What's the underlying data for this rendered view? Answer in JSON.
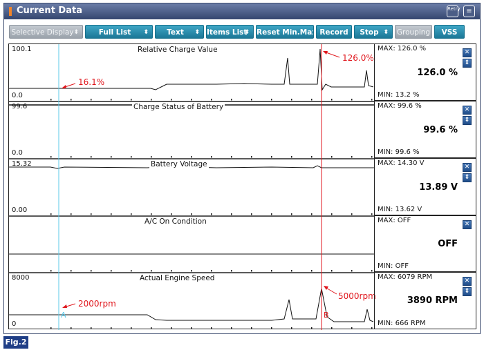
{
  "window": {
    "title": "Current Data"
  },
  "toolbar": {
    "selective_display": "Selective Display",
    "full_list": "Full List",
    "text": "Text",
    "items_list": "Items List",
    "reset_minmax": "Reset Min.Max",
    "record": "Record",
    "stop": "Stop",
    "grouping": "Grouping",
    "vss": "VSS"
  },
  "icons": {
    "retry": "Retry",
    "menu": "menu-icon"
  },
  "graphs": [
    {
      "title": "Relative Charge Value",
      "max": "100.1",
      "min": "0.0",
      "panel_max": "MAX: 126.0 %",
      "panel_value": "126.0 %",
      "panel_min": "MIN: 13.2 %"
    },
    {
      "title": "Charge Status of Battery",
      "max": "99.6",
      "min": "0.0",
      "panel_max": "MAX: 99.6 %",
      "panel_value": "99.6 %",
      "panel_min": "MIN: 99.6 %"
    },
    {
      "title": "Battery Voltage",
      "max": "15.32",
      "min": "0.00",
      "panel_max": "MAX: 14.30 V",
      "panel_value": "13.89 V",
      "panel_min": "MIN: 13.62 V"
    },
    {
      "title": "A/C On Condition",
      "max": "",
      "min": "",
      "panel_max": "MAX: OFF",
      "panel_value": "OFF",
      "panel_min": "MIN: OFF"
    },
    {
      "title": "Actual Engine Speed",
      "max": "8000",
      "min": "0",
      "panel_max": "MAX: 6079 RPM",
      "panel_value": "3890 RPM",
      "panel_min": "MIN: 666 RPM"
    }
  ],
  "annotations": {
    "a1": "16.1%",
    "a2": "126.0%",
    "a3": "2000rpm",
    "a4": "5000rpm"
  },
  "cursors": {
    "a": "A",
    "b": "B"
  },
  "figure_label": "Fig.2",
  "colors": {
    "title_bar": "#34466f",
    "button": "#1b7796",
    "annotation": "#e0161c",
    "cursor_a": "#5bc8e8",
    "cursor_b": "#e0161c"
  }
}
